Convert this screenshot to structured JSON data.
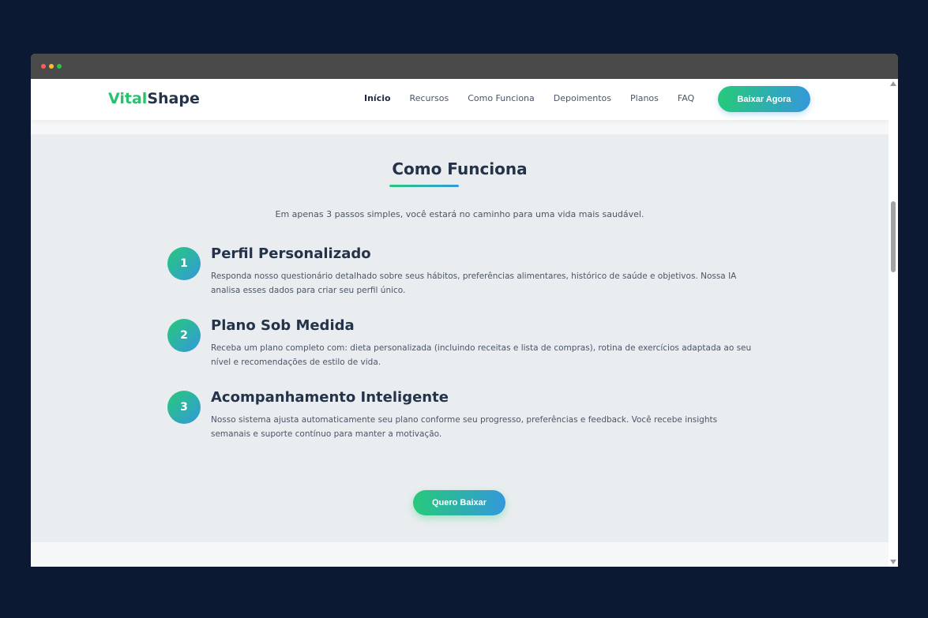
{
  "brand": {
    "name_part1": "Vital",
    "name_part2": "Shape",
    "color_primary": "#27c26b",
    "color_dark": "#24324a",
    "gradient": [
      "#27c97a",
      "#3498db"
    ]
  },
  "nav": {
    "items": [
      {
        "label": "Início",
        "active": true
      },
      {
        "label": "Recursos",
        "active": false
      },
      {
        "label": "Como Funciona",
        "active": false
      },
      {
        "label": "Depoimentos",
        "active": false
      },
      {
        "label": "Planos",
        "active": false
      },
      {
        "label": "FAQ",
        "active": false
      }
    ],
    "cta_label": "Baixar Agora"
  },
  "how_it_works": {
    "title": "Como Funciona",
    "subtitle": "Em apenas 3 passos simples, você estará no caminho para uma vida mais saudável.",
    "steps": [
      {
        "number": "1",
        "title": "Perfil Personalizado",
        "description": "Responda nosso questionário detalhado sobre seus hábitos, preferências alimentares, histórico de saúde e objetivos. Nossa IA analisa esses dados para criar seu perfil único."
      },
      {
        "number": "2",
        "title": "Plano Sob Medida",
        "description": "Receba um plano completo com: dieta personalizada (incluindo receitas e lista de compras), rotina de exercícios adaptada ao seu nível e recomendações de estilo de vida."
      },
      {
        "number": "3",
        "title": "Acompanhamento Inteligente",
        "description": "Nosso sistema ajusta automaticamente seu plano conforme seu progresso, preferências e feedback. Você recebe insights semanais e suporte contínuo para manter a motivação."
      }
    ],
    "cta_label": "Quero Baixar"
  }
}
